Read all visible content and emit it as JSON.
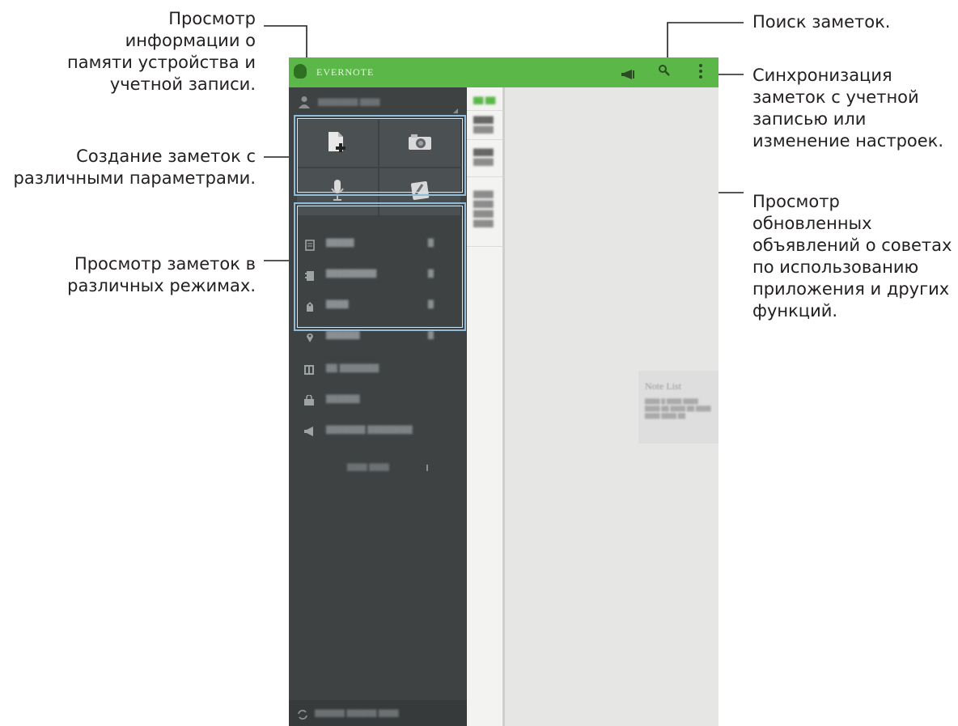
{
  "callouts": {
    "storage": "Просмотр\nинформации о\nпамяти устройства и\nучетной записи.",
    "create": "Создание заметок с\nразличными параметрами.",
    "views": "Просмотр заметок в\nразличных режимах.",
    "search": "Поиск заметок.",
    "sync": "Синхронизация\nзаметок с учетной\nзаписью или\nизменение настроек.",
    "announcements": "Просмотр\nобновленных\nобъявлений о советах\nпо использованию\nприложения и других\nфункций."
  },
  "app": {
    "title": "EVERNOTE",
    "accent_color": "#5bb848",
    "sidebar_color": "#3e4243",
    "toolbar_icons": [
      "megaphone-icon",
      "search-icon",
      "more-vertical-icon"
    ]
  },
  "create_tiles": [
    "new-note-icon",
    "camera-icon",
    "microphone-icon",
    "attachment-icon"
  ],
  "placeholder": {
    "title": "Note List"
  }
}
